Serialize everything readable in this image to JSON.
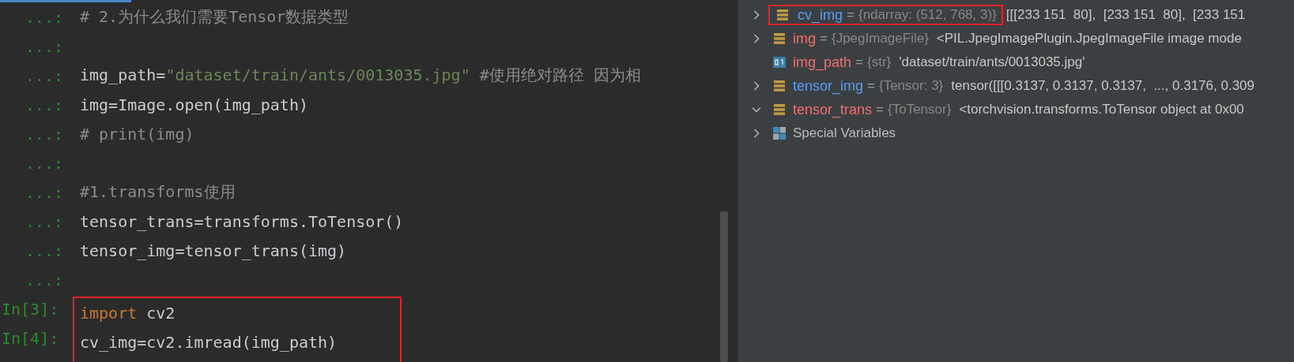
{
  "console": {
    "blocks": [
      {
        "boxed": false,
        "lines": [
          {
            "prompt": "...:",
            "segments": [
              {
                "kind": "comment",
                "text": "# 2.为什么我们需要Tensor数据类型"
              }
            ]
          },
          {
            "prompt": "...:"
          },
          {
            "prompt": "...:",
            "segments": [
              {
                "kind": "plain",
                "text": "img_path="
              },
              {
                "kind": "string",
                "text": "\"dataset/train/ants/0013035.jpg\""
              },
              {
                "kind": "comment",
                "text": " #使用绝对路径 因为相"
              }
            ]
          },
          {
            "prompt": "...:",
            "segments": [
              {
                "kind": "plain",
                "text": "img=Image.open(img_path)"
              }
            ]
          },
          {
            "prompt": "...:",
            "segments": [
              {
                "kind": "comment",
                "text": "# print(img)"
              }
            ]
          },
          {
            "prompt": "...:"
          },
          {
            "prompt": "...:",
            "segments": [
              {
                "kind": "comment",
                "text": "#1.transforms使用"
              }
            ]
          },
          {
            "prompt": "...:",
            "segments": [
              {
                "kind": "plain",
                "text": "tensor_trans=transforms.ToTensor()"
              }
            ]
          },
          {
            "prompt": "...:",
            "segments": [
              {
                "kind": "plain",
                "text": "tensor_img=tensor_trans(img)"
              }
            ]
          },
          {
            "prompt": "...:"
          }
        ]
      },
      {
        "boxed": true,
        "lines": [
          {
            "prompt": "In[3]:",
            "segments": [
              {
                "kind": "keyword",
                "text": "import"
              },
              {
                "kind": "plain",
                "text": " cv2"
              }
            ]
          },
          {
            "prompt": "In[4]:",
            "segments": [
              {
                "kind": "plain",
                "text": "cv_img=cv2.imread(img_path)"
              }
            ]
          }
        ]
      }
    ]
  },
  "variables": [
    {
      "name": "cv_img",
      "color": "#589df6",
      "eq": "=",
      "type": "{ndarray: (512, 768, 3)}",
      "value": "[[[233 151  80],  [233 151  80],  [233 151",
      "kind": "object",
      "expanded": false,
      "boxed": true
    },
    {
      "name": "img",
      "color": "#f07070",
      "eq": "=",
      "type": "{JpegImageFile}",
      "value": "<PIL.JpegImagePlugin.JpegImageFile image mode",
      "kind": "object",
      "expanded": false,
      "boxed": false
    },
    {
      "name": "img_path",
      "color": "#f07070",
      "eq": "=",
      "type": "{str}",
      "value": "'dataset/train/ants/0013035.jpg'",
      "kind": "str",
      "boxed": false
    },
    {
      "name": "tensor_img",
      "color": "#589df6",
      "eq": "=",
      "type": "{Tensor: 3}",
      "value": "tensor([[[0.3137, 0.3137, 0.3137,  ..., 0.3176, 0.309",
      "kind": "object",
      "expanded": false,
      "boxed": false
    },
    {
      "name": "tensor_trans",
      "color": "#f07070",
      "eq": "=",
      "type": "{ToTensor}",
      "value": "<torchvision.transforms.ToTensor object at 0x00",
      "kind": "object",
      "expanded": true,
      "boxed": false
    },
    {
      "name": "Special Variables",
      "kind": "special",
      "expanded": false,
      "boxed": false
    }
  ]
}
